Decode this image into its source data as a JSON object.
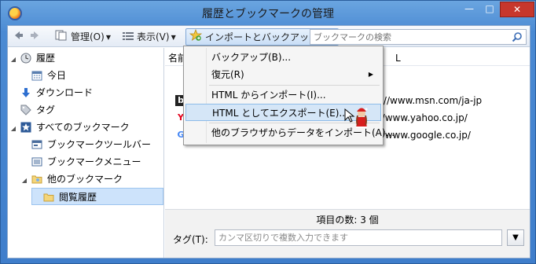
{
  "window": {
    "title": "履歴とブックマークの管理",
    "controls": {
      "minimize": "—",
      "maximize": "□",
      "close": "✕"
    }
  },
  "toolbar": {
    "back_icon": "back-arrow-icon",
    "forward_icon": "forward-arrow-icon",
    "organize_label": "管理(O)",
    "views_label": "表示(V)",
    "import_backup_label": "インポートとバックアップ(I)",
    "search_placeholder": "ブックマークの検索"
  },
  "tree": [
    {
      "label": "履歴",
      "twisty": "◢",
      "icon": "history-clock-icon"
    },
    {
      "label": "今日",
      "twisty": "",
      "icon": "calendar-icon"
    },
    {
      "label": "ダウンロード",
      "twisty": "",
      "icon": "download-arrow-icon"
    },
    {
      "label": "タグ",
      "twisty": "",
      "icon": "tag-icon"
    },
    {
      "label": "すべてのブックマーク",
      "twisty": "◢",
      "icon": "star-bookmark-icon"
    },
    {
      "label": "ブックマークツールバー",
      "twisty": "",
      "icon": "toolbar-folder-icon"
    },
    {
      "label": "ブックマークメニュー",
      "twisty": "",
      "icon": "menu-folder-icon"
    },
    {
      "label": "他のブックマーク",
      "twisty": "◢",
      "icon": "folder-icon"
    },
    {
      "label": "閲覧履歴",
      "twisty": "",
      "icon": "folder-icon",
      "selected": true
    }
  ],
  "list": {
    "column_name": "名前",
    "column_url": "L",
    "rows": [
      {
        "favicon": "msn-favicon",
        "url": "ps://www.msn.com/ja-jp"
      },
      {
        "favicon": "yahoo-favicon",
        "url": "p://www.yahoo.co.jp/"
      },
      {
        "favicon": "google-favicon",
        "url": "p://www.google.co.jp/"
      }
    ]
  },
  "details": {
    "item_count": "項目の数: 3 個",
    "tag_label": "タグ(T):",
    "tag_placeholder": "カンマ区切りで複数入力できます"
  },
  "menu": {
    "items": [
      {
        "label": "バックアップ(B)..."
      },
      {
        "label": "復元(R)",
        "submenu": "▶"
      },
      {
        "label": "HTML からインポート(I)..."
      },
      {
        "label": "HTML としてエクスポート(E)...",
        "highlighted": true
      },
      {
        "label": "他のブラウザからデータをインポート(A)..."
      }
    ]
  },
  "colors": {
    "titlebar": "#4b8ad3",
    "selection": "#cde3fb",
    "menu_highlight": "#d5e6f7",
    "close_button": "#c7372c"
  }
}
